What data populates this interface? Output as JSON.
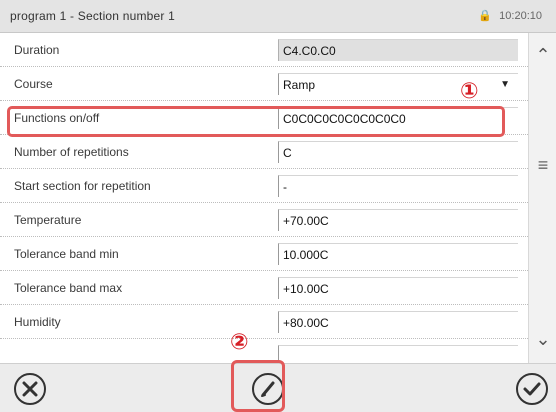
{
  "header": {
    "title": "program 1 - Section number 1",
    "status": "10:20:10",
    "lock_icon": "lock-icon"
  },
  "rows": [
    {
      "label": "Duration",
      "value": "C4.C0.C0",
      "type": "readonly"
    },
    {
      "label": "Course",
      "value": "Ramp",
      "type": "select"
    },
    {
      "label": "Functions on/off",
      "value": "C0C0C0C0C0C0C0C0",
      "type": "text"
    },
    {
      "label": "Number of repetitions",
      "value": "C",
      "type": "text"
    },
    {
      "label": "Start section for repetition",
      "value": "-",
      "type": "text"
    },
    {
      "label": "Temperature",
      "value": "+70.00C",
      "type": "text"
    },
    {
      "label": "Tolerance band min",
      "value": "10.000C",
      "type": "text"
    },
    {
      "label": "Tolerance band max",
      "value": "+10.00C",
      "type": "text"
    },
    {
      "label": "Humidity",
      "value": "+80.00C",
      "type": "text"
    },
    {
      "label": "",
      "value": "",
      "type": "text"
    }
  ],
  "markers": {
    "one": "①",
    "two": "②"
  },
  "scrollbar": {
    "up_icon": "chevron-up-icon",
    "thumb_icon": "grip-icon",
    "down_icon": "chevron-down-icon"
  },
  "buttons": {
    "cancel_icon": "close-icon",
    "edit_icon": "pencil-icon",
    "confirm_icon": "check-icon"
  },
  "colors": {
    "highlight": "#e25a5a",
    "marker": "#d61f26"
  }
}
